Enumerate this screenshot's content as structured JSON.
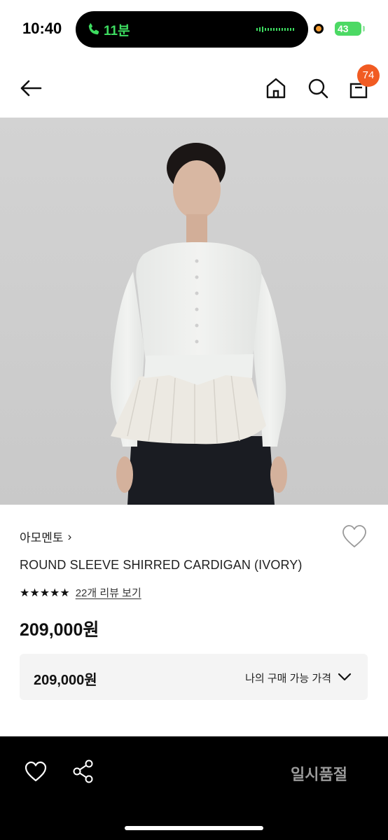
{
  "status_bar": {
    "time": "10:40",
    "call_text": "11분",
    "battery": "43"
  },
  "nav": {
    "cart_count": "74"
  },
  "product": {
    "brand": "아모멘토",
    "brand_chevron": "›",
    "title": "ROUND SLEEVE SHIRRED CARDIGAN (IVORY)",
    "stars": "★★★★★",
    "review_link": "22개 리뷰 보기",
    "price": "209,000원"
  },
  "price_box": {
    "amount": "209,000원",
    "label": "나의 구매 가능 가격"
  },
  "bottom_bar": {
    "soldout_label": "일시품절"
  },
  "colors": {
    "accent_badge": "#f15b22",
    "call_green": "#3ddc60",
    "battery_green": "#4cd964"
  }
}
